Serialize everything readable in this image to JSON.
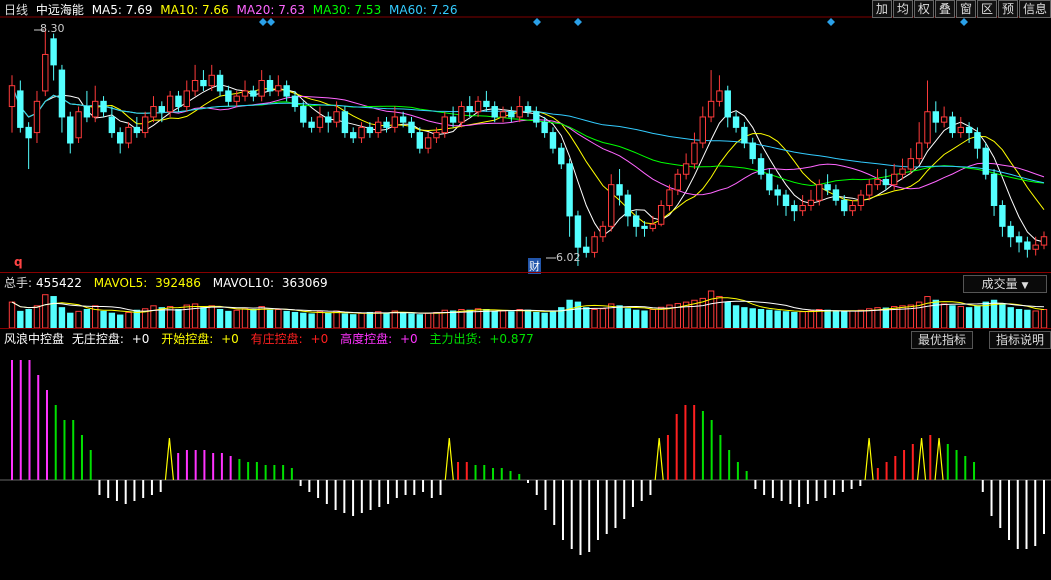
{
  "colors": {
    "up": "#ff3b3b",
    "down": "#54ffff",
    "ma5": "#ffffff",
    "ma10": "#ffff00",
    "ma20": "#ff66ff",
    "ma30": "#00ff00",
    "ma60": "#33ccff",
    "grid": "#800000",
    "white": "#ffffff",
    "yellow": "#ffff00",
    "red": "#ff2020",
    "green": "#00e000",
    "magenta": "#ff33ff",
    "diamond": "#2aa0e8"
  },
  "main": {
    "period_label": "日线",
    "stock_name": "中远海能",
    "ma": [
      {
        "label": "MA5: 7.69",
        "key": "ma5"
      },
      {
        "label": "MA10: 7.66",
        "key": "ma10"
      },
      {
        "label": "MA20: 7.63",
        "key": "ma20"
      },
      {
        "label": "MA30: 7.53",
        "key": "ma30"
      },
      {
        "label": "MA60: 7.26",
        "key": "ma60"
      }
    ],
    "toolbar": [
      "加",
      "均",
      "权",
      "叠",
      "窗",
      "区",
      "预",
      "信息"
    ],
    "high_label": "8.30",
    "low_label": "6.02",
    "low_marker": "财",
    "side_marker": "q"
  },
  "volume": {
    "items": [
      {
        "label": "总手:",
        "value": "455422",
        "key": "white"
      },
      {
        "label": "MAVOL5:",
        "value": "392486",
        "key": "yellow"
      },
      {
        "label": "MAVOL10:",
        "value": "363069",
        "key": "white"
      }
    ],
    "button": "成交量"
  },
  "indicator": {
    "title": "风浪中控盘",
    "items": [
      {
        "label": "无庄控盘:",
        "value": "+0",
        "key": "white"
      },
      {
        "label": "开始控盘:",
        "value": "+0",
        "key": "yellow"
      },
      {
        "label": "有庄控盘:",
        "value": "+0",
        "key": "red"
      },
      {
        "label": "高度控盘:",
        "value": "+0",
        "key": "magenta"
      },
      {
        "label": "主力出货:",
        "value": "+0.877",
        "key": "green"
      }
    ],
    "buttons": [
      "最优指标",
      "指标说明"
    ]
  },
  "chart_data": [
    {
      "type": "candlestick",
      "title": "中远海能",
      "ylim": [
        6.0,
        8.4
      ],
      "annotations": [
        {
          "text": "8.30",
          "value": 8.3
        },
        {
          "text": "6.02",
          "value": 6.02
        }
      ],
      "candles": [
        [
          7.55,
          7.75,
          7.85,
          7.3
        ],
        [
          7.7,
          7.35,
          7.8,
          7.3
        ],
        [
          7.35,
          7.25,
          7.4,
          6.95
        ],
        [
          7.3,
          7.6,
          7.7,
          7.2
        ],
        [
          7.7,
          8.05,
          8.3,
          7.65
        ],
        [
          8.2,
          7.95,
          8.25,
          7.8
        ],
        [
          7.9,
          7.45,
          7.95,
          7.3
        ],
        [
          7.45,
          7.2,
          7.5,
          7.1
        ],
        [
          7.25,
          7.5,
          7.55,
          7.2
        ],
        [
          7.55,
          7.45,
          7.7,
          7.4
        ],
        [
          7.45,
          7.6,
          7.75,
          7.4
        ],
        [
          7.6,
          7.5,
          7.65,
          7.45
        ],
        [
          7.45,
          7.3,
          7.55,
          7.25
        ],
        [
          7.3,
          7.2,
          7.35,
          7.1
        ],
        [
          7.2,
          7.35,
          7.4,
          7.15
        ],
        [
          7.35,
          7.3,
          7.45,
          7.25
        ],
        [
          7.3,
          7.45,
          7.5,
          7.25
        ],
        [
          7.45,
          7.55,
          7.65,
          7.4
        ],
        [
          7.55,
          7.5,
          7.6,
          7.4
        ],
        [
          7.5,
          7.65,
          7.7,
          7.45
        ],
        [
          7.65,
          7.55,
          7.7,
          7.5
        ],
        [
          7.55,
          7.7,
          7.8,
          7.5
        ],
        [
          7.7,
          7.8,
          7.95,
          7.65
        ],
        [
          7.8,
          7.75,
          7.9,
          7.7
        ],
        [
          7.75,
          7.85,
          7.95,
          7.7
        ],
        [
          7.85,
          7.7,
          7.9,
          7.65
        ],
        [
          7.7,
          7.6,
          7.75,
          7.55
        ],
        [
          7.6,
          7.65,
          7.7,
          7.55
        ],
        [
          7.65,
          7.7,
          7.8,
          7.6
        ],
        [
          7.7,
          7.65,
          7.75,
          7.6
        ],
        [
          7.65,
          7.8,
          7.9,
          7.6
        ],
        [
          7.8,
          7.7,
          7.85,
          7.65
        ],
        [
          7.7,
          7.75,
          7.85,
          7.65
        ],
        [
          7.75,
          7.65,
          7.8,
          7.6
        ],
        [
          7.65,
          7.55,
          7.7,
          7.5
        ],
        [
          7.55,
          7.4,
          7.6,
          7.35
        ],
        [
          7.4,
          7.35,
          7.45,
          7.3
        ],
        [
          7.35,
          7.45,
          7.55,
          7.3
        ],
        [
          7.45,
          7.4,
          7.5,
          7.3
        ],
        [
          7.4,
          7.5,
          7.6,
          7.35
        ],
        [
          7.5,
          7.3,
          7.55,
          7.25
        ],
        [
          7.3,
          7.25,
          7.35,
          7.2
        ],
        [
          7.25,
          7.35,
          7.4,
          7.2
        ],
        [
          7.35,
          7.3,
          7.4,
          7.25
        ],
        [
          7.3,
          7.4,
          7.45,
          7.25
        ],
        [
          7.4,
          7.35,
          7.45,
          7.3
        ],
        [
          7.35,
          7.45,
          7.55,
          7.3
        ],
        [
          7.45,
          7.4,
          7.5,
          7.35
        ],
        [
          7.4,
          7.3,
          7.45,
          7.25
        ],
        [
          7.3,
          7.15,
          7.35,
          7.1
        ],
        [
          7.15,
          7.25,
          7.3,
          7.1
        ],
        [
          7.25,
          7.3,
          7.35,
          7.2
        ],
        [
          7.3,
          7.45,
          7.5,
          7.25
        ],
        [
          7.45,
          7.4,
          7.55,
          7.35
        ],
        [
          7.4,
          7.55,
          7.6,
          7.35
        ],
        [
          7.55,
          7.5,
          7.65,
          7.45
        ],
        [
          7.5,
          7.6,
          7.65,
          7.45
        ],
        [
          7.6,
          7.55,
          7.7,
          7.5
        ],
        [
          7.55,
          7.45,
          7.6,
          7.4
        ],
        [
          7.45,
          7.5,
          7.55,
          7.4
        ],
        [
          7.5,
          7.45,
          7.55,
          7.4
        ],
        [
          7.45,
          7.55,
          7.65,
          7.4
        ],
        [
          7.55,
          7.5,
          7.6,
          7.45
        ],
        [
          7.5,
          7.4,
          7.55,
          7.35
        ],
        [
          7.4,
          7.3,
          7.45,
          7.25
        ],
        [
          7.3,
          7.15,
          7.35,
          7.1
        ],
        [
          7.15,
          7.0,
          7.2,
          6.95
        ],
        [
          7.0,
          6.5,
          7.05,
          6.3
        ],
        [
          6.5,
          6.2,
          6.55,
          6.02
        ],
        [
          6.2,
          6.15,
          6.3,
          6.1
        ],
        [
          6.15,
          6.3,
          6.35,
          6.1
        ],
        [
          6.3,
          6.4,
          6.45,
          6.25
        ],
        [
          6.4,
          6.8,
          6.9,
          6.35
        ],
        [
          6.8,
          6.7,
          6.95,
          6.6
        ],
        [
          6.7,
          6.5,
          6.75,
          6.4
        ],
        [
          6.5,
          6.4,
          6.55,
          6.3
        ],
        [
          6.4,
          6.38,
          6.45,
          6.3
        ],
        [
          6.38,
          6.42,
          6.5,
          6.35
        ],
        [
          6.42,
          6.6,
          6.65,
          6.4
        ],
        [
          6.6,
          6.75,
          6.8,
          6.55
        ],
        [
          6.75,
          6.9,
          6.95,
          6.7
        ],
        [
          6.9,
          7.0,
          7.1,
          6.85
        ],
        [
          7.0,
          7.2,
          7.3,
          6.95
        ],
        [
          7.2,
          7.45,
          7.55,
          7.15
        ],
        [
          7.45,
          7.6,
          7.9,
          7.4
        ],
        [
          7.6,
          7.7,
          7.85,
          7.55
        ],
        [
          7.7,
          7.45,
          7.75,
          7.35
        ],
        [
          7.45,
          7.35,
          7.5,
          7.3
        ],
        [
          7.35,
          7.2,
          7.4,
          7.15
        ],
        [
          7.2,
          7.05,
          7.25,
          7.0
        ],
        [
          7.05,
          6.9,
          7.1,
          6.85
        ],
        [
          6.9,
          6.75,
          6.95,
          6.7
        ],
        [
          6.75,
          6.7,
          6.8,
          6.6
        ],
        [
          6.7,
          6.6,
          6.75,
          6.5
        ],
        [
          6.6,
          6.55,
          6.65,
          6.45
        ],
        [
          6.55,
          6.6,
          6.7,
          6.5
        ],
        [
          6.6,
          6.65,
          6.75,
          6.55
        ],
        [
          6.65,
          6.8,
          6.85,
          6.6
        ],
        [
          6.8,
          6.75,
          6.9,
          6.7
        ],
        [
          6.75,
          6.65,
          6.8,
          6.6
        ],
        [
          6.65,
          6.55,
          6.7,
          6.5
        ],
        [
          6.55,
          6.6,
          6.65,
          6.5
        ],
        [
          6.6,
          6.7,
          6.75,
          6.55
        ],
        [
          6.7,
          6.8,
          6.85,
          6.65
        ],
        [
          6.8,
          6.85,
          6.95,
          6.75
        ],
        [
          6.85,
          6.8,
          6.95,
          6.75
        ],
        [
          6.8,
          6.9,
          7.0,
          6.75
        ],
        [
          6.9,
          6.95,
          7.05,
          6.85
        ],
        [
          6.95,
          7.05,
          7.15,
          6.9
        ],
        [
          7.05,
          7.2,
          7.4,
          7.0
        ],
        [
          7.2,
          7.5,
          7.8,
          7.15
        ],
        [
          7.5,
          7.4,
          7.6,
          7.3
        ],
        [
          7.4,
          7.45,
          7.55,
          7.35
        ],
        [
          7.45,
          7.3,
          7.5,
          7.25
        ],
        [
          7.3,
          7.35,
          7.45,
          7.25
        ],
        [
          7.35,
          7.3,
          7.4,
          7.2
        ],
        [
          7.3,
          7.15,
          7.35,
          7.05
        ],
        [
          7.15,
          6.9,
          7.2,
          6.85
        ],
        [
          6.9,
          6.6,
          6.95,
          6.5
        ],
        [
          6.6,
          6.4,
          6.65,
          6.3
        ],
        [
          6.4,
          6.3,
          6.45,
          6.2
        ],
        [
          6.3,
          6.25,
          6.35,
          6.15
        ],
        [
          6.25,
          6.18,
          6.3,
          6.1
        ],
        [
          6.18,
          6.22,
          6.3,
          6.12
        ],
        [
          6.22,
          6.3,
          6.35,
          6.18
        ]
      ]
    },
    {
      "type": "bar",
      "title": "成交量",
      "series": [
        {
          "name": "总手",
          "values": [
            70,
            45,
            50,
            60,
            90,
            85,
            55,
            40,
            45,
            50,
            60,
            45,
            40,
            35,
            42,
            48,
            52,
            60,
            55,
            58,
            50,
            62,
            65,
            55,
            60,
            50,
            45,
            48,
            52,
            50,
            58,
            48,
            50,
            45,
            42,
            40,
            38,
            45,
            40,
            46,
            38,
            36,
            40,
            42,
            44,
            40,
            46,
            42,
            38,
            36,
            40,
            42,
            48,
            46,
            50,
            48,
            52,
            50,
            44,
            46,
            44,
            50,
            48,
            42,
            40,
            45,
            55,
            75,
            70,
            55,
            50,
            52,
            65,
            60,
            52,
            48,
            46,
            50,
            56,
            62,
            66,
            70,
            75,
            80,
            100,
            85,
            70,
            60,
            55,
            52,
            50,
            48,
            46,
            44,
            42,
            44,
            46,
            50,
            48,
            46,
            44,
            46,
            48,
            52,
            55,
            54,
            58,
            60,
            62,
            70,
            85,
            75,
            65,
            60,
            58,
            55,
            60,
            70,
            75,
            65,
            55,
            50,
            48,
            46,
            50
          ]
        }
      ]
    },
    {
      "type": "bar",
      "title": "风浪中控盘",
      "series": [
        {
          "name": "风浪中控盘",
          "values": [
            4,
            4,
            4,
            3.5,
            3,
            2.5,
            2,
            2,
            1.5,
            1,
            -0.5,
            -0.6,
            -0.7,
            -0.8,
            -0.7,
            -0.6,
            -0.5,
            -0.4,
            1.4,
            0.9,
            1.0,
            1.0,
            1.0,
            0.9,
            0.9,
            0.8,
            0.7,
            0.6,
            0.6,
            0.5,
            0.5,
            0.5,
            0.4,
            -0.2,
            -0.4,
            -0.6,
            -0.8,
            -1.0,
            -1.1,
            -1.2,
            -1.1,
            -1.0,
            -0.9,
            -0.8,
            -0.6,
            -0.5,
            -0.5,
            -0.4,
            -0.6,
            -0.5,
            1.4,
            0.6,
            0.6,
            0.5,
            0.5,
            0.4,
            0.4,
            0.3,
            0.2,
            -0.1,
            -0.5,
            -1.0,
            -1.5,
            -2.0,
            -2.3,
            -2.5,
            -2.4,
            -2.0,
            -1.8,
            -1.6,
            -1.3,
            -0.9,
            -0.7,
            -0.5,
            1.4,
            1.5,
            2.2,
            2.5,
            2.5,
            2.3,
            2.0,
            1.5,
            1.0,
            0.6,
            0.3,
            -0.3,
            -0.5,
            -0.6,
            -0.7,
            -0.8,
            -0.9,
            -0.8,
            -0.7,
            -0.6,
            -0.5,
            -0.4,
            -0.3,
            -0.2,
            1.4,
            0.4,
            0.6,
            0.8,
            1.0,
            1.2,
            1.4,
            1.5,
            1.4,
            1.2,
            1.0,
            0.8,
            0.6,
            -0.4,
            -1.2,
            -1.6,
            -2.0,
            -2.3,
            -2.3,
            -2.2,
            -1.8
          ]
        }
      ]
    }
  ]
}
